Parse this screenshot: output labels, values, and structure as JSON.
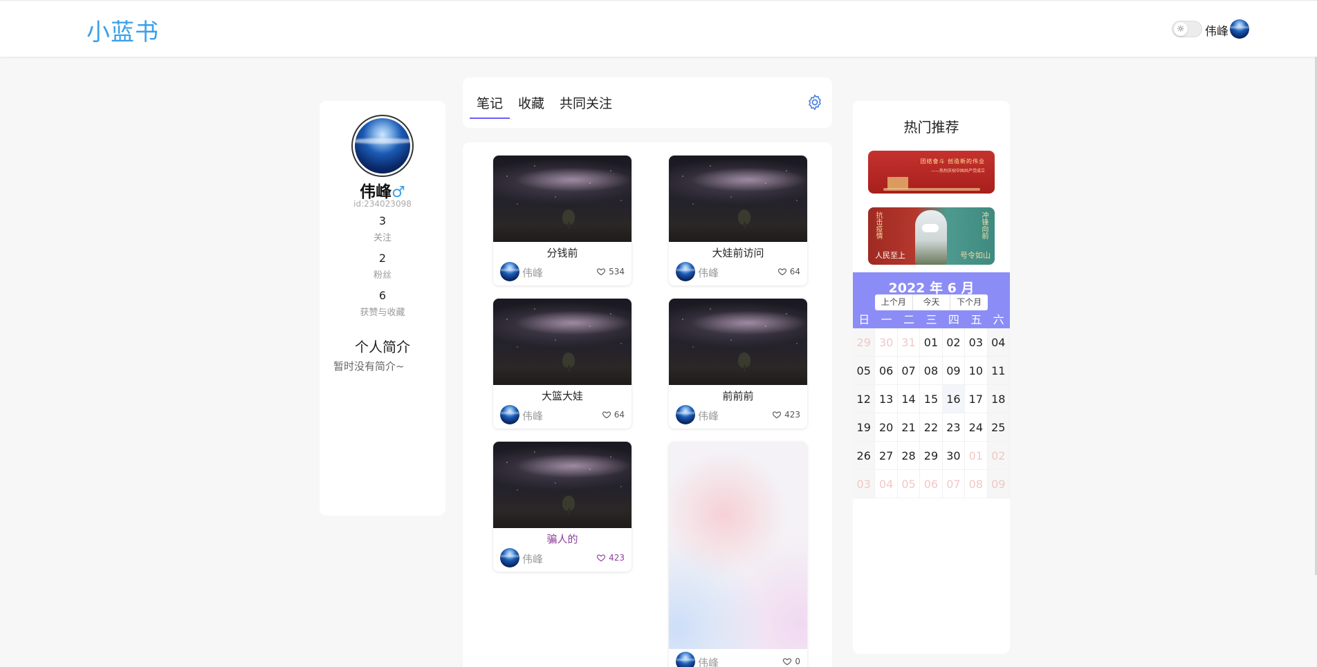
{
  "header": {
    "logo": "小蓝书",
    "user_name": "伟峰",
    "theme_icon": "sun-icon"
  },
  "profile": {
    "name": "伟峰",
    "gender": "♂",
    "id_text": "id:234023098",
    "stats": [
      {
        "num": "3",
        "label": "关注"
      },
      {
        "num": "2",
        "label": "粉丝"
      },
      {
        "num": "6",
        "label": "获赞与收藏"
      }
    ],
    "intro_title": "个人简介",
    "intro_text": "暂时没有简介~"
  },
  "tabs": [
    {
      "label": "笔记",
      "active": true
    },
    {
      "label": "收藏",
      "active": false
    },
    {
      "label": "共同关注",
      "active": false
    }
  ],
  "notes": [
    {
      "title": "分钱前",
      "author": "伟峰",
      "likes": "534"
    },
    {
      "title": "大娃前访问",
      "author": "伟峰",
      "likes": "64"
    },
    {
      "title": "大篮大娃",
      "author": "伟峰",
      "likes": "64"
    },
    {
      "title": "前前前",
      "author": "伟峰",
      "likes": "423"
    },
    {
      "title": "骗人的",
      "author": "伟峰",
      "likes": "423"
    },
    {
      "title": "",
      "author": "伟峰",
      "likes": "0"
    }
  ],
  "right": {
    "title": "热门推荐",
    "banner1_text": "团结奋斗 创造新的伟业",
    "banner1_sub": "——热烈庆祝中国共产党成立",
    "banner2_left_top": "抗击疫情",
    "banner2_left_bottom": "人民至上",
    "banner2_right_top": "冲锋向前",
    "banner2_right_bottom": "号令如山"
  },
  "calendar": {
    "title": "2022 年 6 月",
    "buttons": [
      "上个月",
      "今天",
      "下个月"
    ],
    "weekdays": [
      "日",
      "一",
      "二",
      "三",
      "四",
      "五",
      "六"
    ],
    "rows": [
      [
        "29",
        "30",
        "31",
        "01",
        "02",
        "03",
        "04"
      ],
      [
        "05",
        "06",
        "07",
        "08",
        "09",
        "10",
        "11"
      ],
      [
        "12",
        "13",
        "14",
        "15",
        "16",
        "17",
        "18"
      ],
      [
        "19",
        "20",
        "21",
        "22",
        "23",
        "24",
        "25"
      ],
      [
        "26",
        "27",
        "28",
        "29",
        "30",
        "01",
        "02"
      ],
      [
        "03",
        "04",
        "05",
        "06",
        "07",
        "08",
        "09"
      ]
    ]
  }
}
